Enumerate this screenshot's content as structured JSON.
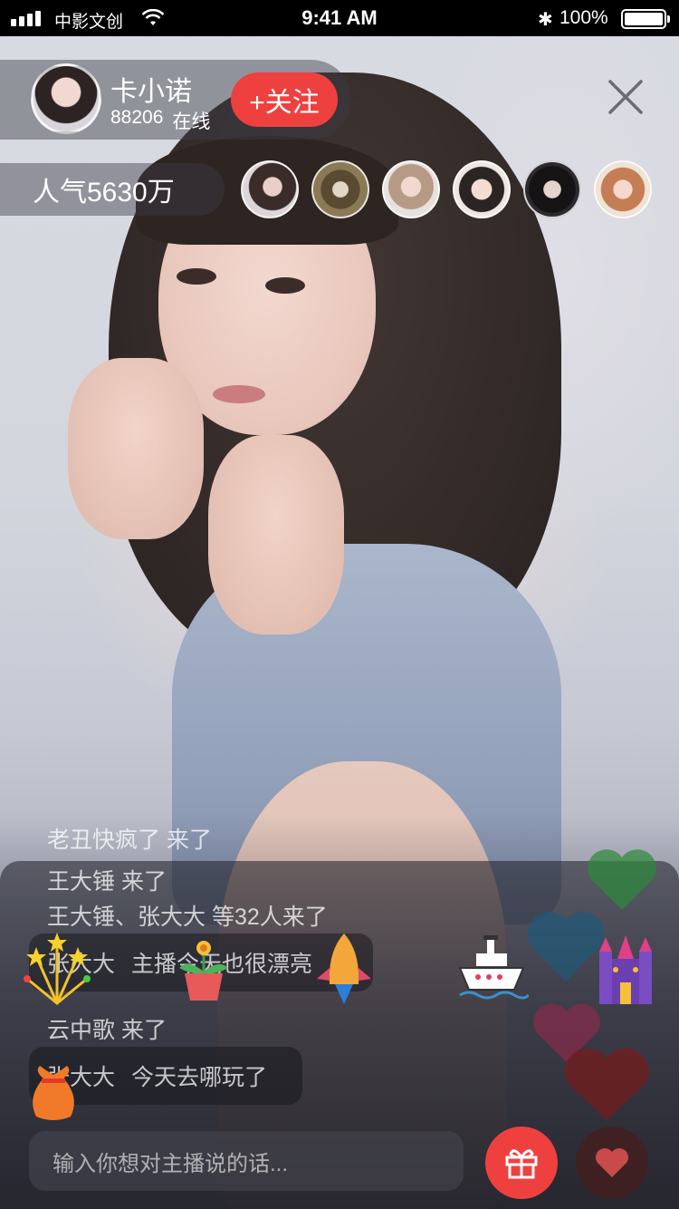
{
  "status_bar": {
    "carrier": "中影文创",
    "time": "9:41 AM",
    "battery": "100%"
  },
  "host": {
    "name": "卡小诺",
    "online_count": "88206",
    "online_label": "在线",
    "follow_label": "+关注"
  },
  "popularity": "人气5630万",
  "viewers": [
    {
      "name": "viewer-1"
    },
    {
      "name": "viewer-2"
    },
    {
      "name": "viewer-3"
    },
    {
      "name": "viewer-4"
    },
    {
      "name": "viewer-5"
    },
    {
      "name": "viewer-6"
    }
  ],
  "chat": {
    "messages": [
      "老丑快疯了 来了",
      "王大锤 来了",
      "王大锤、张大大 等32人来了",
      "云中歌 来了"
    ],
    "bubbles": [
      {
        "user": "张大大",
        "text": "主播今天也很漂亮"
      },
      {
        "user": "张大大",
        "text": "今天去哪玩了"
      }
    ],
    "input_placeholder": "输入你想对主播说的话..."
  },
  "gifts": [
    "fireworks-icon",
    "flower-pot-icon",
    "rocket-icon",
    "cruise-ship-icon",
    "castle-icon",
    "lucky-bag-icon"
  ],
  "colors": {
    "accent": "#ef4040",
    "overlay": "rgba(60,60,70,0.45)"
  }
}
